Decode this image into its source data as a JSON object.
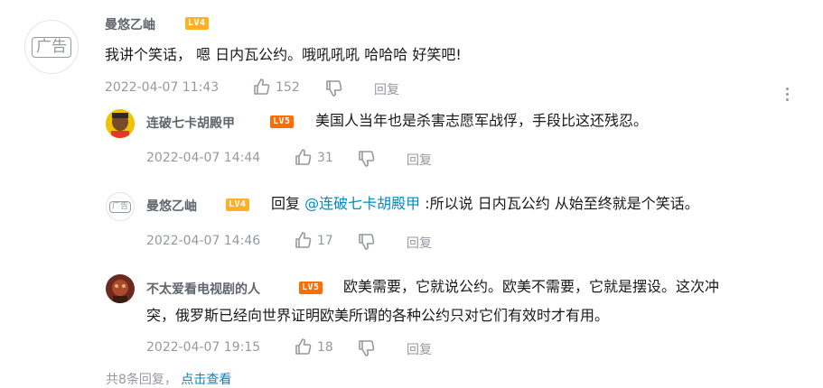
{
  "main_comment": {
    "avatar_label": "广告",
    "username": "曼悠乙岫",
    "level": "LV4",
    "text": "我讲个笑话， 嗯 日内瓦公约。哦吼吼吼 哈哈哈 好笑吧!",
    "date": "2022-04-07 11:43",
    "likes": "152",
    "reply_label": "回复"
  },
  "replies": [
    {
      "username": "连破七卡胡殿甲",
      "level": "LV5",
      "text": "美国人当年也是杀害志愿军战俘，手段比这还残忍。",
      "date": "2022-04-07 14:44",
      "likes": "31",
      "reply_label": "回复"
    },
    {
      "avatar_label": "广告",
      "username": "曼悠乙岫",
      "level": "LV4",
      "reply_prefix": "回复",
      "mention": "@连破七卡胡殿甲",
      "text": ":所以说 日内瓦公约 从始至终就是个笑话。",
      "date": "2022-04-07 14:46",
      "likes": "17",
      "reply_label": "回复"
    },
    {
      "username": "不太爱看电视剧的人",
      "level": "LV5",
      "text_line1": "欧美需要，它就说公约。欧美不需要，它就是摆设。这次冲",
      "text_line2": "突，俄罗斯已经向世界证明欧美所谓的各种公约只对它们有效时才有用。",
      "date": "2022-04-07 19:15",
      "likes": "18",
      "reply_label": "回复"
    }
  ],
  "footer": {
    "count_text": "共8条回复，",
    "more_text": "点击查看"
  },
  "colors": {
    "accent": "#00aeec",
    "mention": "#008ac5",
    "meta": "#9499a0",
    "lv4": "#ffb027",
    "lv5": "#ff6c00"
  }
}
